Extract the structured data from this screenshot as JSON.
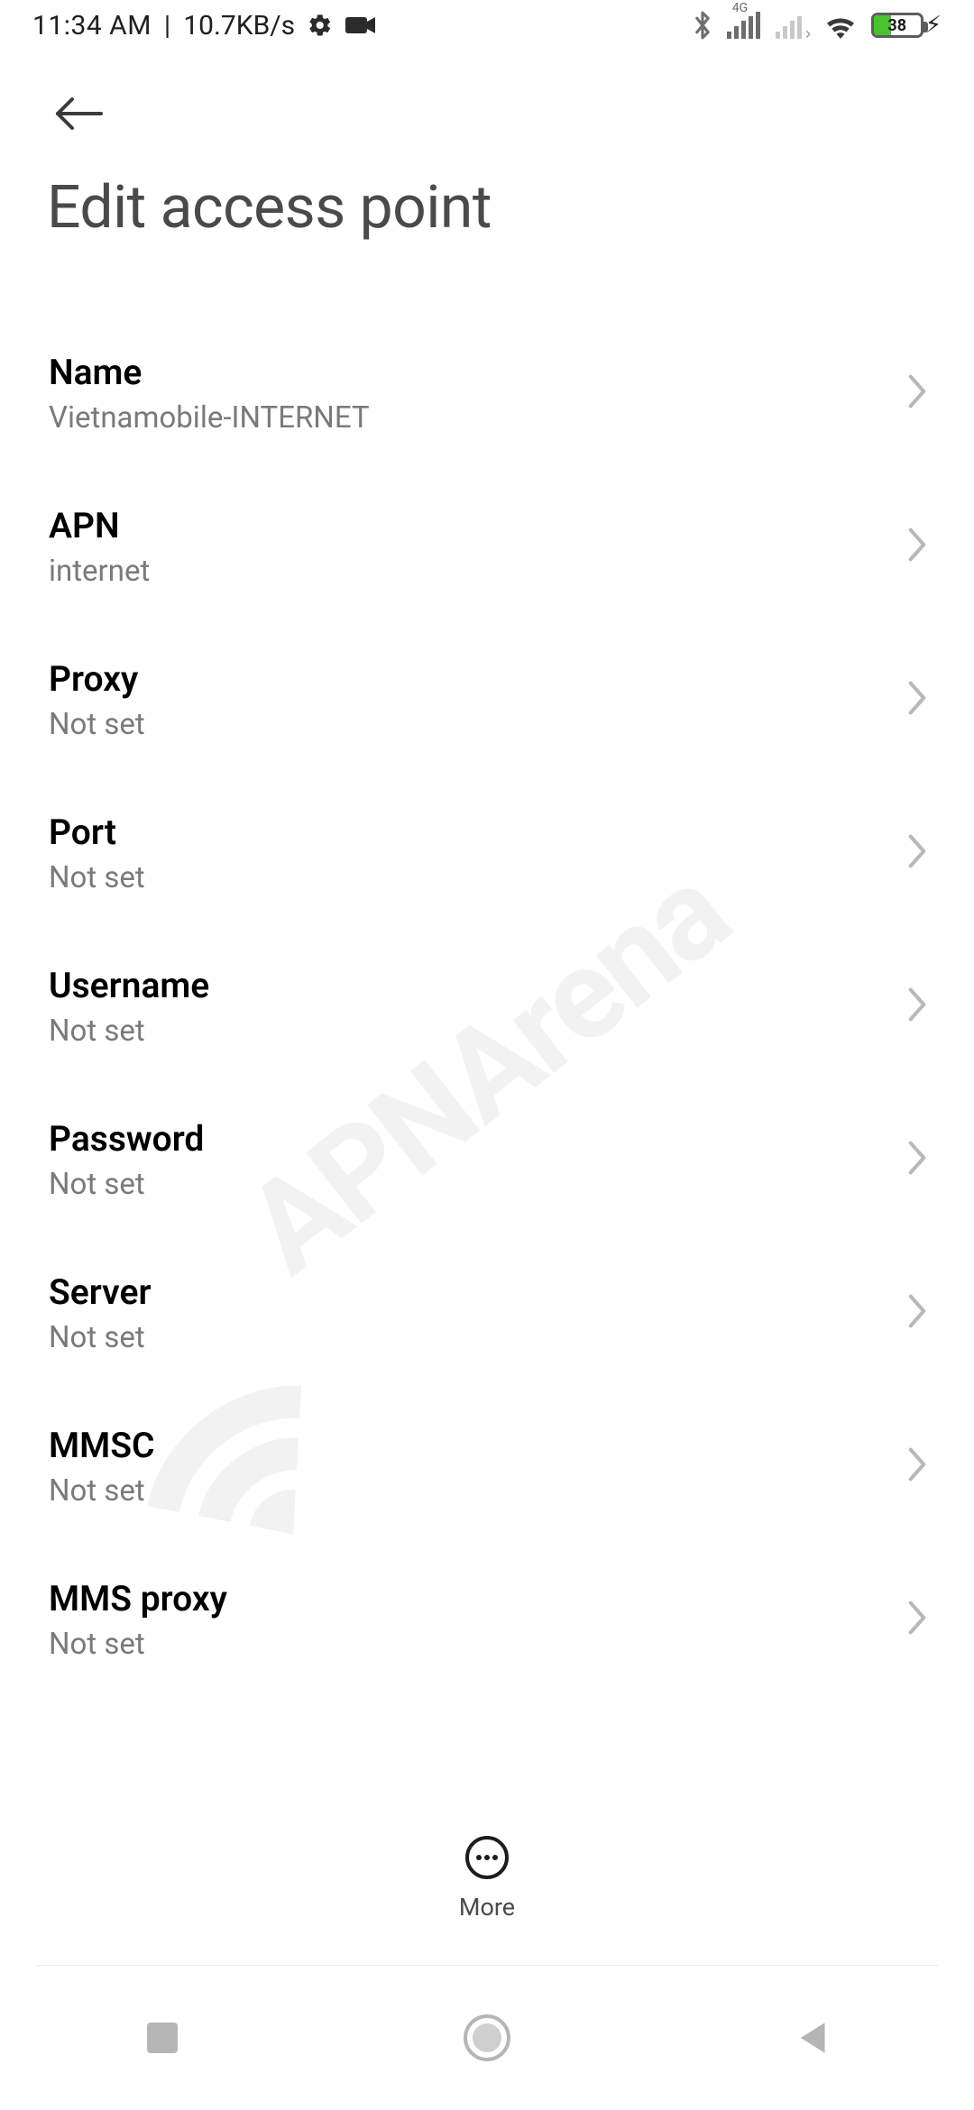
{
  "status": {
    "time": "11:34 AM",
    "separator": "|",
    "net_speed": "10.7KB/s",
    "signal_label": "4G",
    "battery_percent": "38"
  },
  "header": {
    "title": "Edit access point"
  },
  "apn_fields": [
    {
      "label": "Name",
      "value": "Vietnamobile-INTERNET"
    },
    {
      "label": "APN",
      "value": "internet"
    },
    {
      "label": "Proxy",
      "value": "Not set"
    },
    {
      "label": "Port",
      "value": "Not set"
    },
    {
      "label": "Username",
      "value": "Not set"
    },
    {
      "label": "Password",
      "value": "Not set"
    },
    {
      "label": "Server",
      "value": "Not set"
    },
    {
      "label": "MMSC",
      "value": "Not set"
    },
    {
      "label": "MMS proxy",
      "value": "Not set"
    }
  ],
  "toolbar": {
    "more_label": "More"
  },
  "watermark": "APNArena"
}
